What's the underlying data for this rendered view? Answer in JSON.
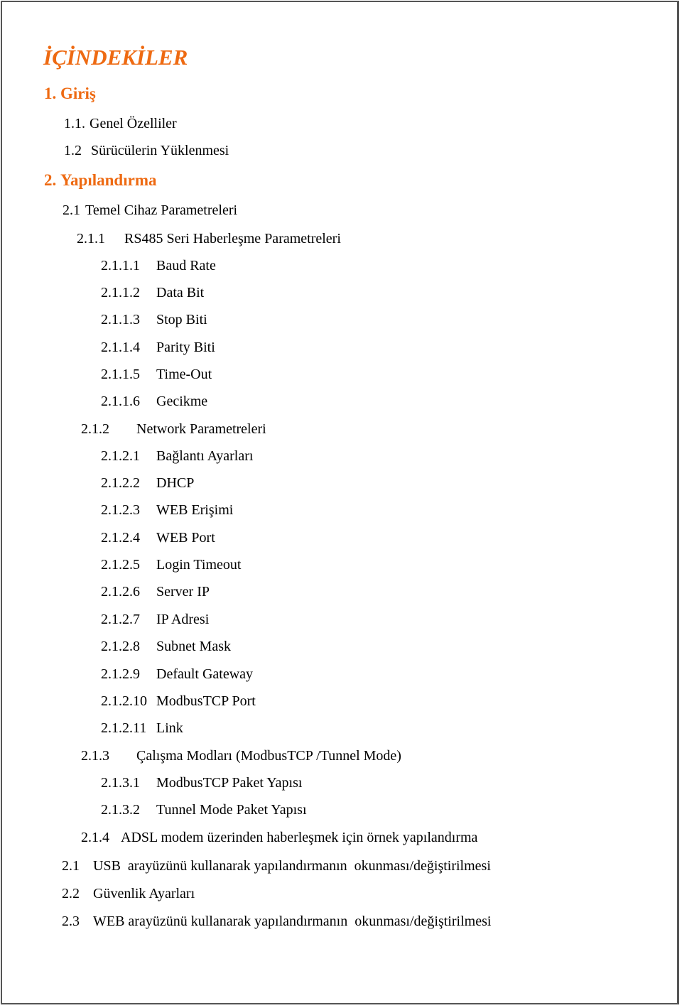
{
  "document": {
    "title": "İÇİNDEKİLER",
    "accent_color": "#ee6a12",
    "entries": [
      {
        "number": "1.",
        "label": "Giriş",
        "level": 0
      },
      {
        "number": "1.1.",
        "label": "Genel Özelliler",
        "level": 1
      },
      {
        "number": "1.2",
        "label": "Sürücülerin Yüklenmesi",
        "level": 1
      },
      {
        "number": "2.",
        "label": "Yapılandırma",
        "level": 0
      },
      {
        "number": "2.1",
        "label": "Temel Cihaz Parametreleri",
        "level": 1
      },
      {
        "number": "2.1.1",
        "label": "RS485 Seri Haberleşme Parametreleri",
        "level": 2
      },
      {
        "number": "2.1.1.1",
        "label": "Baud Rate",
        "level": 3
      },
      {
        "number": "2.1.1.2",
        "label": "Data Bit",
        "level": 3
      },
      {
        "number": "2.1.1.3",
        "label": "Stop Biti",
        "level": 3
      },
      {
        "number": "2.1.1.4",
        "label": "Parity Biti",
        "level": 3
      },
      {
        "number": "2.1.1.5",
        "label": "Time-Out",
        "level": 3
      },
      {
        "number": "2.1.1.6",
        "label": "Gecikme",
        "level": 3
      },
      {
        "number": "2.1.2",
        "label": "Network Parametreleri",
        "level": 2
      },
      {
        "number": "2.1.2.1",
        "label": "Bağlantı Ayarları",
        "level": 3
      },
      {
        "number": "2.1.2.2",
        "label": "DHCP",
        "level": 3
      },
      {
        "number": "2.1.2.3",
        "label": "WEB Erişimi",
        "level": 3
      },
      {
        "number": "2.1.2.4",
        "label": "WEB Port",
        "level": 3
      },
      {
        "number": "2.1.2.5",
        "label": "Login Timeout",
        "level": 3
      },
      {
        "number": "2.1.2.6",
        "label": "Server IP",
        "level": 3
      },
      {
        "number": "2.1.2.7",
        "label": "IP Adresi",
        "level": 3
      },
      {
        "number": "2.1.2.8",
        "label": "Subnet Mask",
        "level": 3
      },
      {
        "number": "2.1.2.9",
        "label": "Default Gateway",
        "level": 3
      },
      {
        "number": "2.1.2.10",
        "label": "ModbusTCP Port",
        "level": 3
      },
      {
        "number": "2.1.2.11",
        "label": "Link",
        "level": 3
      },
      {
        "number": "2.1.3",
        "label": "Çalışma Modları (ModbusTCP /Tunnel Mode)",
        "level": 2
      },
      {
        "number": "2.1.3.1",
        "label": "ModbusTCP Paket Yapısı",
        "level": 3
      },
      {
        "number": "2.1.3.2",
        "label": "Tunnel Mode Paket Yapısı",
        "level": 3
      },
      {
        "number": "2.1.4",
        "label": "ADSL modem üzerinden haberleşmek için örnek yapılandırma",
        "level": 2
      },
      {
        "number": "2.1",
        "label": "USB  arayüzünü kullanarak yapılandırmanın  okunması/değiştirilmesi",
        "level": 1
      },
      {
        "number": "2.2",
        "label": "Güvenlik Ayarları",
        "level": 1
      },
      {
        "number": "2.3",
        "label": "WEB arayüzünü kullanarak yapılandırmanın  okunması/değiştirilmesi",
        "level": 1
      }
    ]
  }
}
